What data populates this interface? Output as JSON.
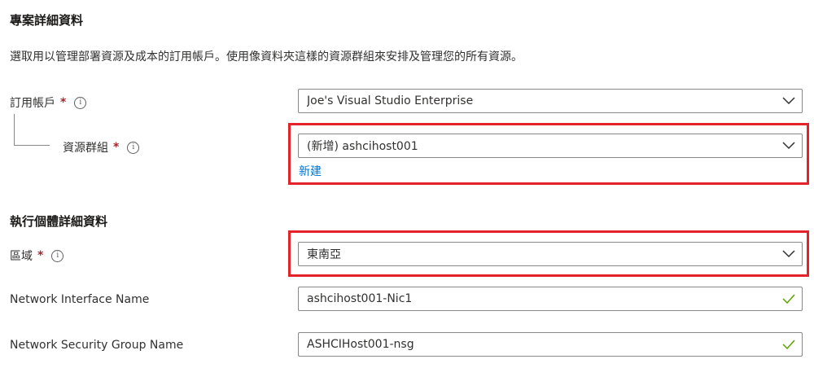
{
  "project": {
    "heading": "專案詳細資料",
    "description": "選取用以管理部署資源及成本的訂用帳戶。使用像資料夾這樣的資源群組來安排及管理您的所有資源。"
  },
  "subscription": {
    "label": "訂用帳戶",
    "required_mark": "*",
    "info_glyph": "i",
    "value": "Joe's Visual Studio Enterprise"
  },
  "resource_group": {
    "label": "資源群組",
    "required_mark": "*",
    "info_glyph": "i",
    "value": "(新增) ashcihost001",
    "create_new_link": "新建"
  },
  "instance": {
    "heading": "執行個體詳細資料"
  },
  "region": {
    "label": "區域",
    "required_mark": "*",
    "info_glyph": "i",
    "value": "東南亞"
  },
  "nic": {
    "label": "Network Interface Name",
    "value": "ashcihost001-Nic1"
  },
  "nsg": {
    "label": "Network Security Group Name",
    "value": "ASHCIHost001-nsg"
  },
  "colors": {
    "highlight": "#e3222a",
    "link": "#0078d4",
    "valid_check": "#57a300",
    "required": "#a4262c"
  },
  "icons": [
    "chevron-down-icon",
    "checkmark-icon",
    "info-icon"
  ]
}
